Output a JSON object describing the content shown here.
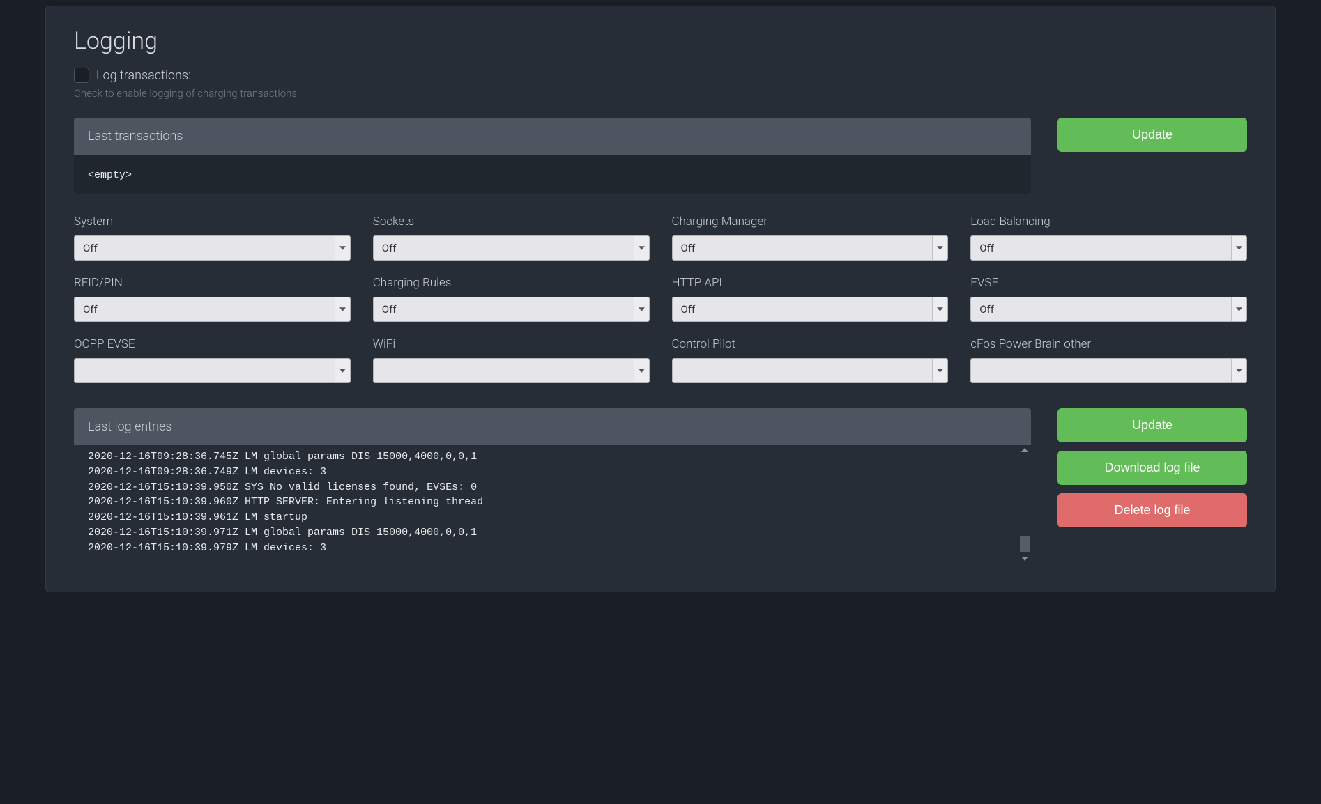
{
  "title": "Logging",
  "log_transactions": {
    "label": "Log transactions:",
    "checked": false,
    "help": "Check to enable logging of charging transactions"
  },
  "last_transactions": {
    "header": "Last transactions",
    "body": "<empty>"
  },
  "buttons": {
    "update": "Update",
    "download": "Download log file",
    "delete": "Delete log file"
  },
  "selects": [
    {
      "label": "System",
      "value": "Off"
    },
    {
      "label": "Sockets",
      "value": "Off"
    },
    {
      "label": "Charging Manager",
      "value": "Off"
    },
    {
      "label": "Load Balancing",
      "value": "Off"
    },
    {
      "label": "RFID/PIN",
      "value": "Off"
    },
    {
      "label": "Charging Rules",
      "value": "Off"
    },
    {
      "label": "HTTP API",
      "value": "Off"
    },
    {
      "label": "EVSE",
      "value": "Off"
    },
    {
      "label": "OCPP EVSE",
      "value": ""
    },
    {
      "label": "WiFi",
      "value": ""
    },
    {
      "label": "Control Pilot",
      "value": ""
    },
    {
      "label": "cFos Power Brain other",
      "value": ""
    }
  ],
  "last_log": {
    "header": "Last log entries",
    "lines": [
      "2020-12-16T09:28:36.745Z LM global params DIS 15000,4000,0,0,1",
      "2020-12-16T09:28:36.749Z LM devices: 3",
      "2020-12-16T15:10:39.950Z SYS No valid licenses found, EVSEs: 0",
      "2020-12-16T15:10:39.960Z HTTP SERVER: Entering listening thread",
      "2020-12-16T15:10:39.961Z LM startup",
      "2020-12-16T15:10:39.971Z LM global params DIS 15000,4000,0,0,1",
      "2020-12-16T15:10:39.979Z LM devices: 3"
    ]
  }
}
